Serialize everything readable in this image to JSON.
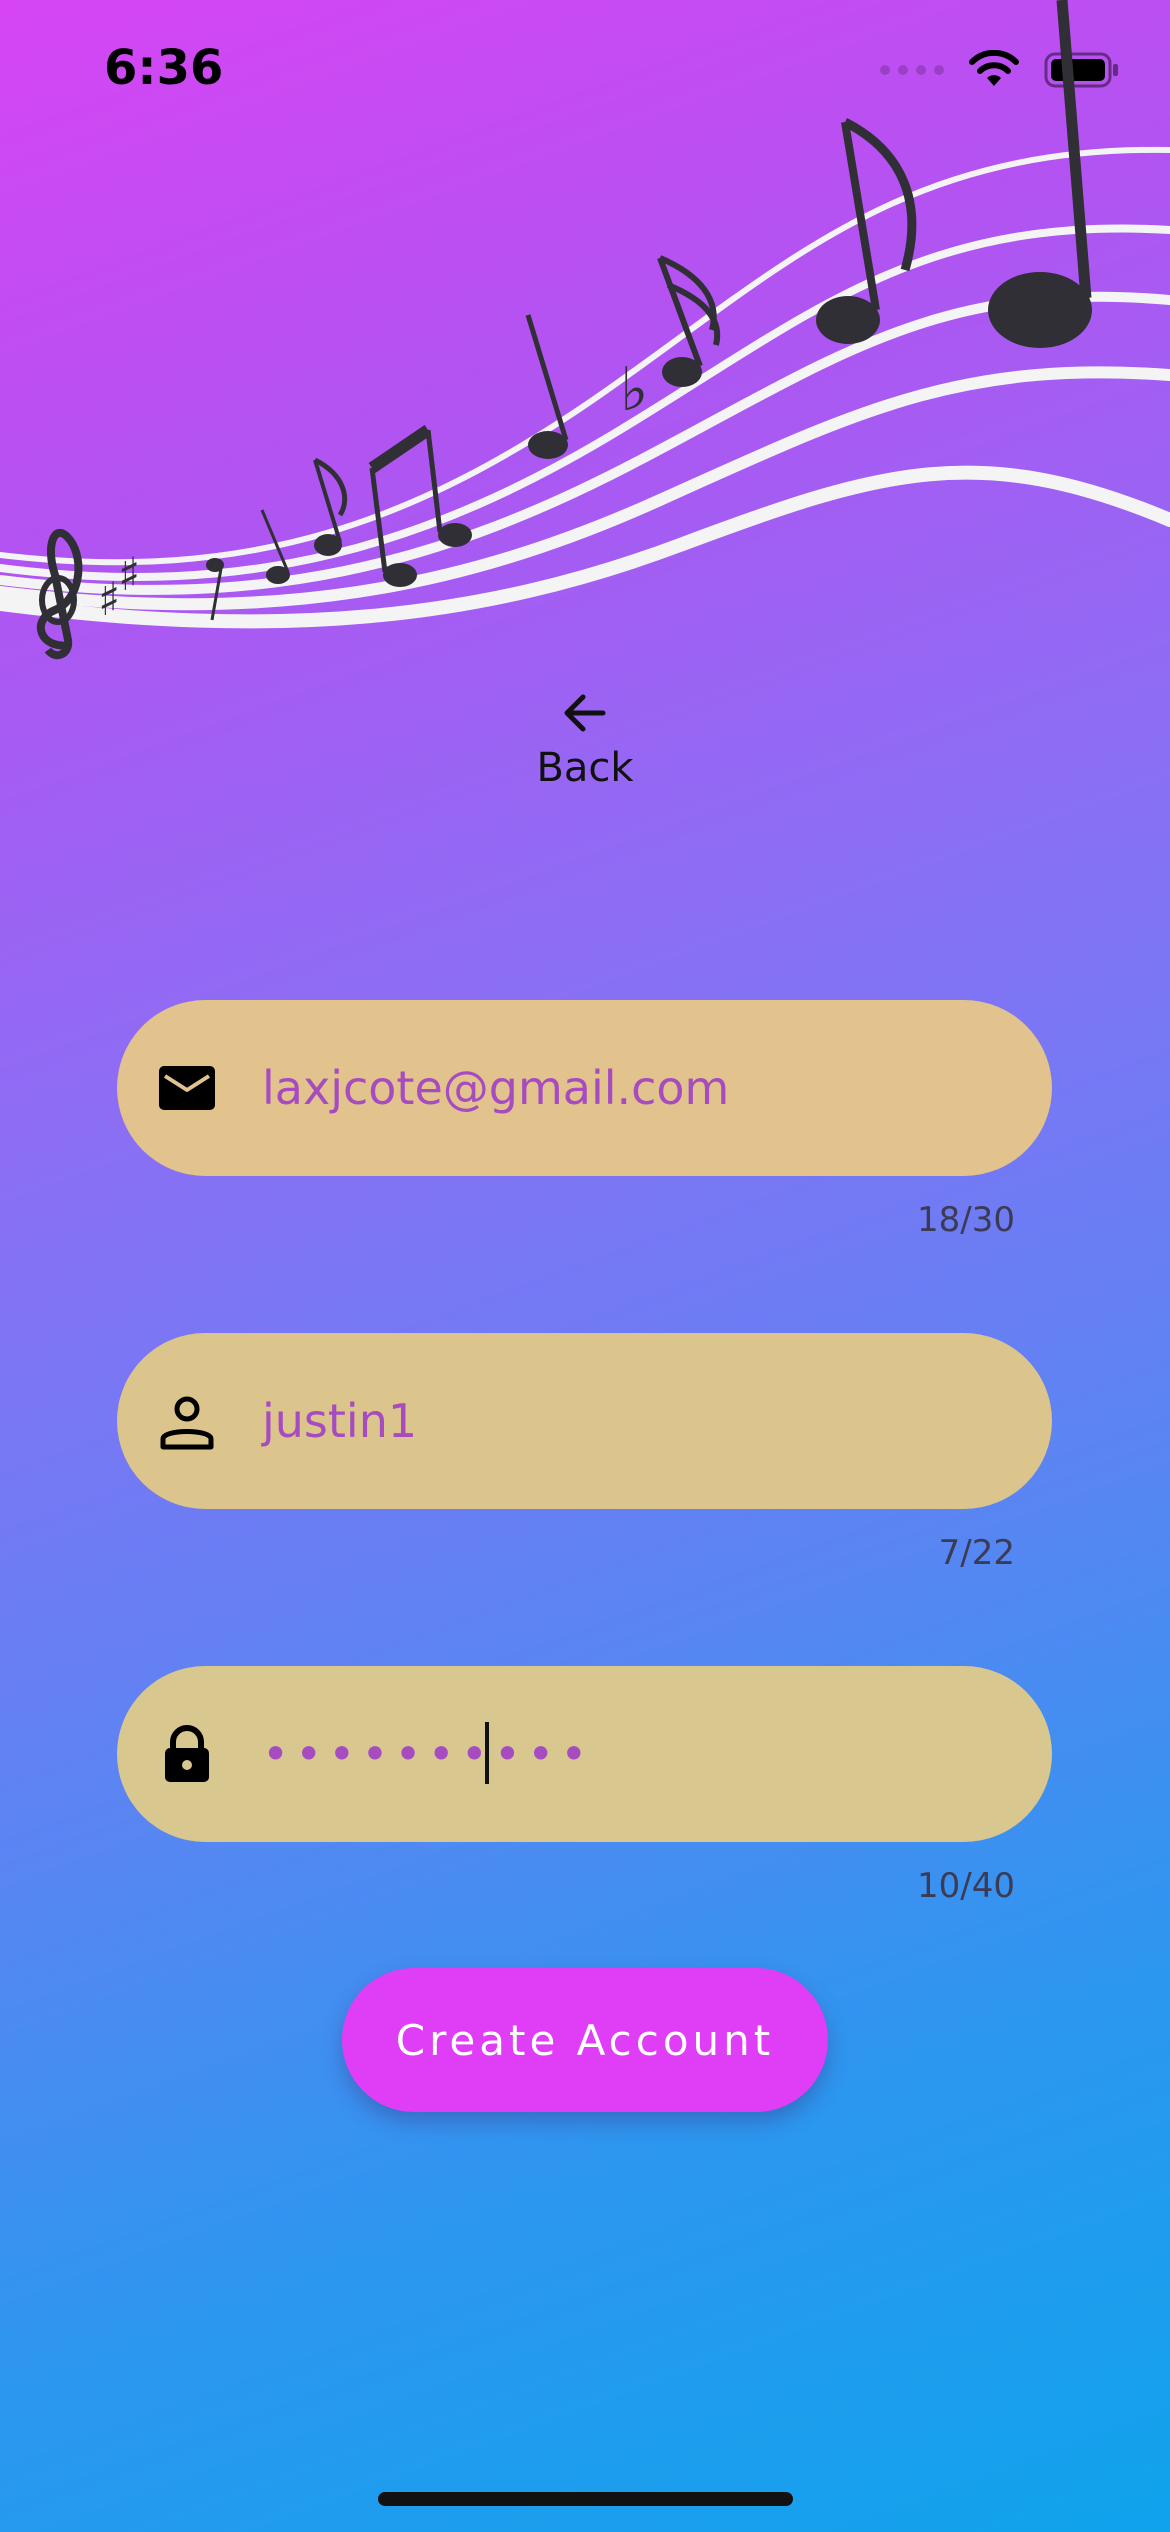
{
  "status_bar": {
    "time": "6:36"
  },
  "nav": {
    "back_label": "Back"
  },
  "form": {
    "email": {
      "icon": "envelope-icon",
      "value": "laxjcote@gmail.com",
      "counter": "18/30"
    },
    "username": {
      "icon": "person-icon",
      "value": "justin1",
      "counter": "7/22"
    },
    "password": {
      "icon": "lock-icon",
      "value": "••••••••••",
      "counter": "10/40"
    }
  },
  "actions": {
    "create_account_label": "Create Account"
  },
  "colors": {
    "gradient_top": "#d645f3",
    "gradient_bottom": "#0fa3ec",
    "field_fill": "#e2c28d",
    "field_text": "#a64cc0",
    "button": "#e03ef6"
  }
}
